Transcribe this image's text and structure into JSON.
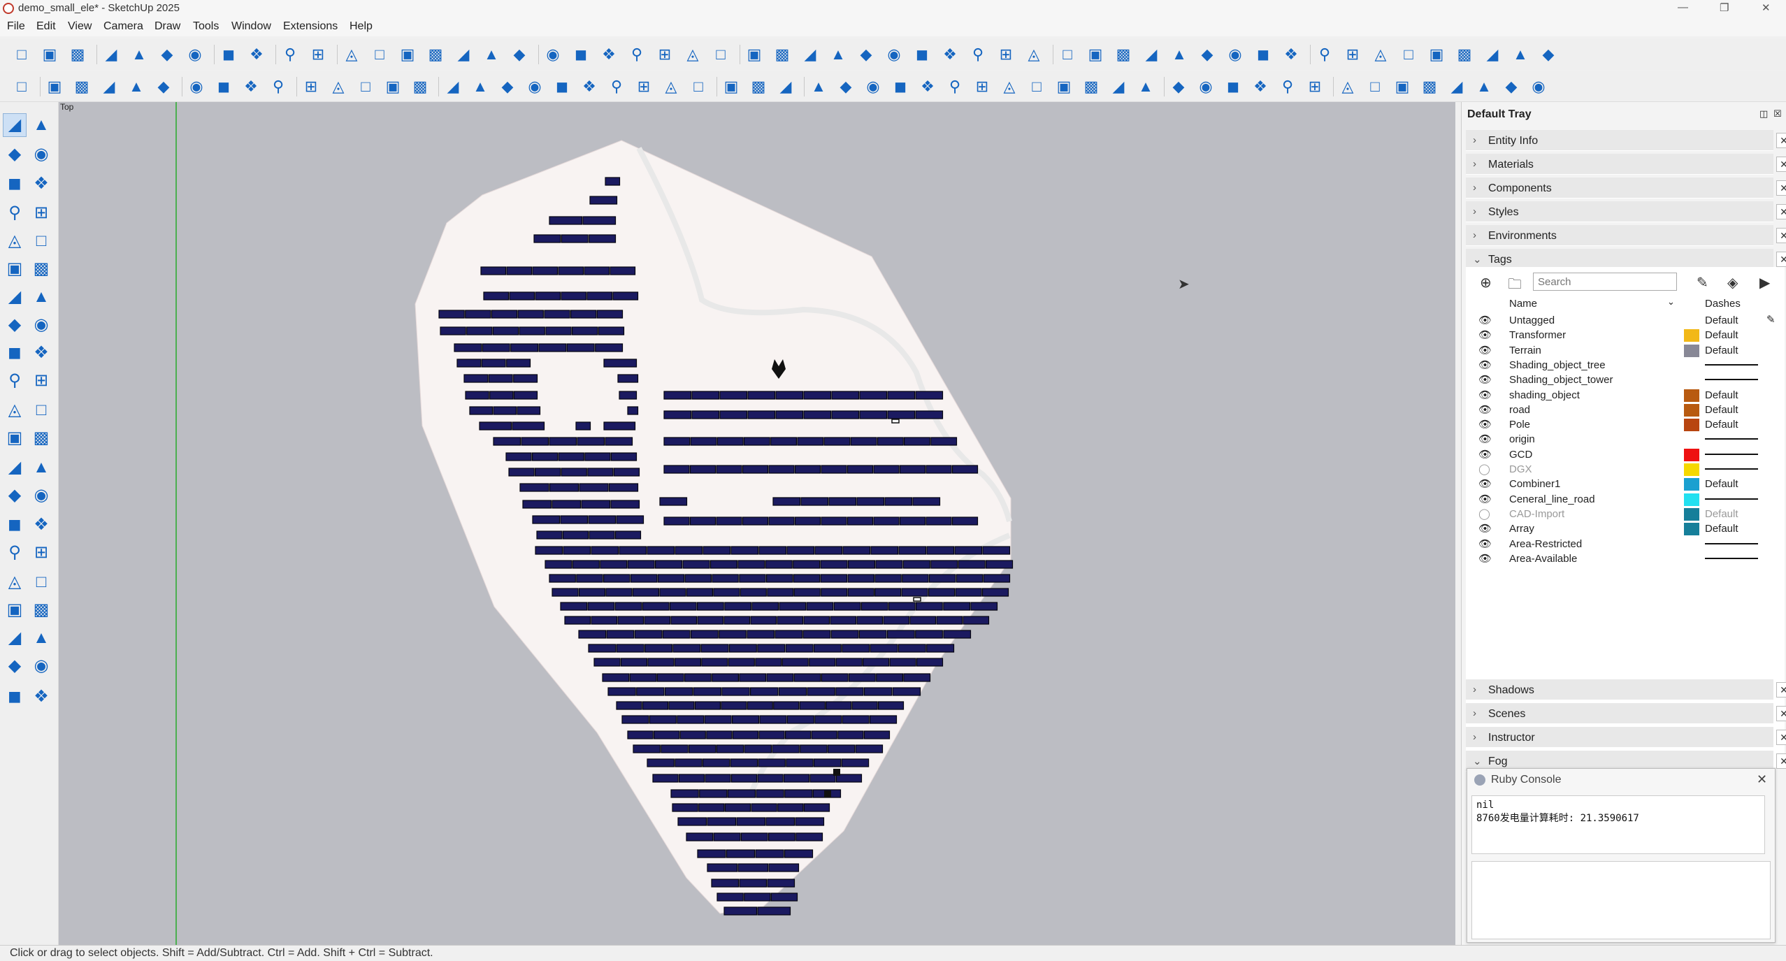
{
  "window": {
    "title": "demo_small_ele* - SketchUp 2025"
  },
  "menu": [
    "File",
    "Edit",
    "View",
    "Camera",
    "Draw",
    "Tools",
    "Window",
    "Extensions",
    "Help"
  ],
  "viewport": {
    "view_label": "Top"
  },
  "status": {
    "text": "Click or drag to select objects. Shift = Add/Subtract. Ctrl = Add. Shift + Ctrl = Subtract."
  },
  "tray": {
    "title": "Default Tray",
    "panels_top": [
      "Entity Info",
      "Materials",
      "Components",
      "Styles",
      "Environments"
    ],
    "tags_panel": "Tags",
    "search_placeholder": "Search",
    "columns": {
      "name": "Name",
      "dashes": "Dashes"
    },
    "tags": [
      {
        "name": "Untagged",
        "visible": true,
        "color": "",
        "dashes": "Default",
        "pencil": true
      },
      {
        "name": "Transformer",
        "visible": true,
        "color": "#f2b817",
        "dashes": "Default"
      },
      {
        "name": "Terrain",
        "visible": true,
        "color": "#888896",
        "dashes": "Default"
      },
      {
        "name": "Shading_object_tree",
        "visible": true,
        "color": "",
        "dashes": ""
      },
      {
        "name": "Shading_object_tower",
        "visible": true,
        "color": "",
        "dashes": ""
      },
      {
        "name": "shading_object",
        "visible": true,
        "color": "#b85a10",
        "dashes": "Default"
      },
      {
        "name": "road",
        "visible": true,
        "color": "#b85a10",
        "dashes": "Default"
      },
      {
        "name": "Pole",
        "visible": true,
        "color": "#b84510",
        "dashes": "Default"
      },
      {
        "name": "origin",
        "visible": true,
        "color": "",
        "dashes": ""
      },
      {
        "name": "GCD",
        "visible": true,
        "color": "#ee1111",
        "dashes": ""
      },
      {
        "name": "DGX",
        "visible": false,
        "color": "#f5d800",
        "dashes": ""
      },
      {
        "name": "Combiner1",
        "visible": true,
        "color": "#1aa0d0",
        "dashes": "Default"
      },
      {
        "name": "Ceneral_line_road",
        "visible": true,
        "color": "#22e0f0",
        "dashes": ""
      },
      {
        "name": "CAD-Import",
        "visible": false,
        "color": "#167f9a",
        "dashes": "Default"
      },
      {
        "name": "Array",
        "visible": true,
        "color": "#167f9a",
        "dashes": "Default"
      },
      {
        "name": "Area-Restricted",
        "visible": true,
        "color": "",
        "dashes": ""
      },
      {
        "name": "Area-Available",
        "visible": true,
        "color": "",
        "dashes": ""
      }
    ],
    "panels_bottom": [
      "Shadows",
      "Scenes",
      "Instructor",
      "Fog"
    ]
  },
  "ruby_console": {
    "title": "Ruby Console",
    "lines": [
      "nil",
      "8760发电量计算耗时: 21.3590617"
    ]
  },
  "icons": {
    "tb1": [
      "new-file-icon",
      "open-icon",
      "save-icon",
      "cut-icon",
      "copy-icon",
      "paste-icon",
      "erase-icon",
      "undo-icon",
      "redo-icon",
      "print-icon",
      "model-info-icon",
      "iso-view-icon",
      "top-view-icon",
      "front-view-icon",
      "right-view-icon",
      "back-view-icon",
      "left-view-icon",
      "xray-icon",
      "back-edges-icon",
      "wireframe-icon",
      "hidden-line-icon",
      "shaded-icon",
      "shaded-textures-icon",
      "monochrome-icon",
      "warehouse-icon",
      "text-icon",
      "plugin-icon",
      "pole-icon",
      "tower-icon",
      "tower2-icon",
      "box-icon",
      "grid-icon",
      "section-icon",
      "scale-icon",
      "hide-icon",
      "hide2-icon",
      "zoom-icon",
      "dimension-icon",
      "tape-icon",
      "protractor-icon",
      "layers-icon",
      "swap-icon",
      "stack-icon",
      "lock-icon",
      "slope-icon",
      "tree-icon",
      "group-icon",
      "table-icon",
      "pv-icon",
      "tool1-icon",
      "tool2-icon",
      "tool3-icon",
      "tool4-icon",
      "tool5-icon"
    ],
    "tb2": [
      "list-icon",
      "sun-icon",
      "globe-icon",
      "select-box-icon",
      "terrain-icon",
      "mountain-icon",
      "column-icon",
      "panel-icon",
      "array-icon",
      "array2-icon",
      "delete-icon",
      "percent-icon",
      "spark-icon",
      "spark2-icon",
      "road-icon",
      "grid2-icon",
      "cabinet-icon",
      "cable-icon",
      "search-circle-icon",
      "wave-icon",
      "search2-icon",
      "gauge-icon",
      "link-icon",
      "fence-icon",
      "axis-icon",
      "box2-icon",
      "plus-box-icon",
      "cloud-cad-icon",
      "ruler-icon",
      "layout-icon",
      "image-icon",
      "slope2-icon",
      "move-icon",
      "table2-icon",
      "sliders-icon",
      "dropbox-icon",
      "coins-icon",
      "yen-icon",
      "kwh-icon",
      "irr-icon",
      "report-icon",
      "gear-icon",
      "users-icon",
      "en-icon",
      "help-icon",
      "cloud-icon",
      "refresh-icon",
      "database-icon",
      "loss-icon",
      "bi-icon",
      "play-icon",
      "tool6-icon",
      "tool7-icon",
      "tool8-icon",
      "tool9-icon"
    ],
    "left": [
      "select-icon",
      "lasso-icon",
      "paint-icon",
      "eraser-icon",
      "component-icon",
      "tag-icon",
      "pencil-icon",
      "freehand-icon",
      "rectangle-icon",
      "rotated-rect-icon",
      "circle-icon",
      "polygon-icon",
      "arc-icon",
      "arc2-icon",
      "pie-icon",
      "arc3-icon",
      "move-tool-icon",
      "push-pull-icon",
      "rotate-icon",
      "follow-me-icon",
      "scale-tool-icon",
      "offset-icon",
      "tape-tool-icon",
      "protractor-tool-icon",
      "dimension-tool-icon",
      "text-tool-icon",
      "axes-icon",
      "3d-text-icon",
      "section-tool-icon",
      "hand-icon",
      "zoom-tool-icon",
      "zoom-window-icon",
      "zoom-extents-icon",
      "previous-view-icon",
      "position-camera-icon",
      "walk-icon",
      "look-around-icon",
      "section-plane-icon",
      "sandbox1-icon",
      "sandbox2-icon",
      "sandbox3-icon",
      "sandbox4-icon"
    ]
  }
}
